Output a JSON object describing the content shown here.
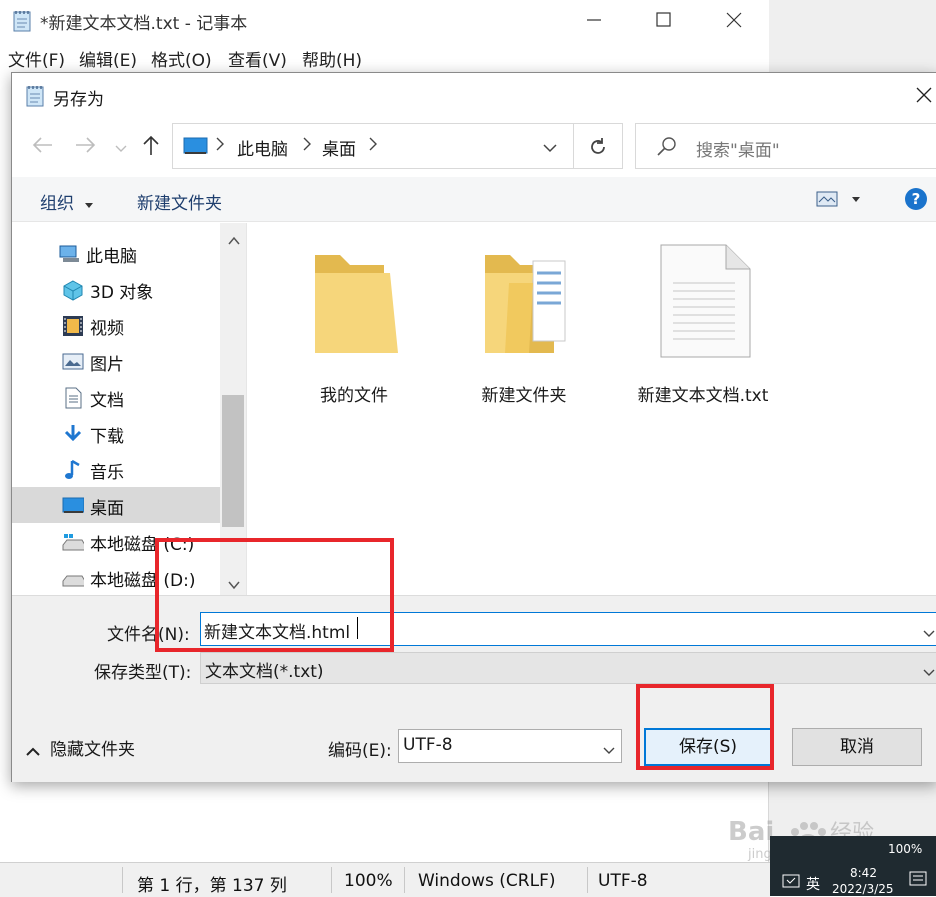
{
  "notepad": {
    "title": "*新建文本文档.txt - 记事本",
    "menu": [
      "文件(F)",
      "编辑(E)",
      "格式(O)",
      "查看(V)",
      "帮助(H)"
    ],
    "status": {
      "position": "第 1 行，第 137 列",
      "zoom": "100%",
      "line_ending": "Windows (CRLF)",
      "encoding": "UTF-8"
    }
  },
  "dialog": {
    "title": "另存为",
    "breadcrumb": [
      "此电脑",
      "桌面"
    ],
    "search_placeholder": "搜索\"桌面\"",
    "toolbar": {
      "organize": "组织",
      "new_folder": "新建文件夹"
    },
    "nav_items": [
      "此电脑",
      "3D 对象",
      "视频",
      "图片",
      "文档",
      "下载",
      "音乐",
      "桌面",
      "本地磁盘 (C:)",
      "本地磁盘 (D:)"
    ],
    "files": [
      {
        "name": "我的文件",
        "type": "folder"
      },
      {
        "name": "新建文件夹",
        "type": "folder-docs"
      },
      {
        "name": "新建文本文档.txt",
        "type": "text-file"
      }
    ],
    "filename_label": "文件名(N):",
    "filename_value": "新建文本文档.html",
    "filetype_label": "保存类型(T):",
    "filetype_value": "文本文档(*.txt)",
    "hide_folders": "隐藏文件夹",
    "encoding_label": "编码(E):",
    "encoding_value": "UTF-8",
    "save_button": "保存(S)",
    "cancel_button": "取消"
  },
  "taskbar": {
    "ime": "英",
    "time": "8:42",
    "date": "2022/3/25",
    "zoom": "100%"
  },
  "watermark": "Baidu经验 jingyan.baidu.com",
  "colors": {
    "highlight": "#e8262b",
    "selection": "#cce8ff",
    "accent": "#0078d7"
  }
}
